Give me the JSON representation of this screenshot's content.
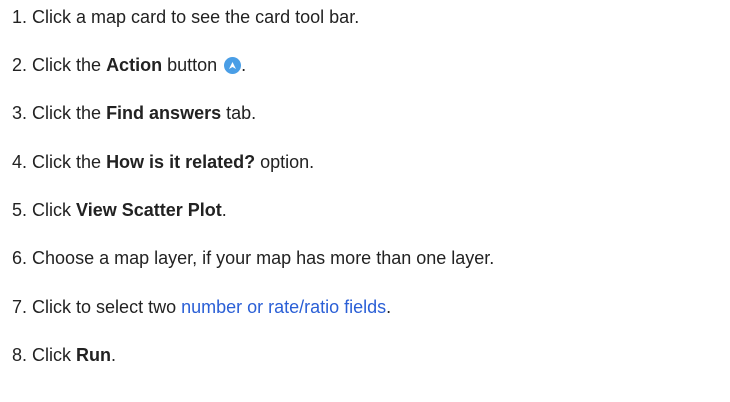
{
  "steps": [
    {
      "num": "1.",
      "text": "Click a map card to see the card tool bar."
    },
    {
      "num": "2.",
      "pre": "Click the ",
      "bold": "Action",
      "post": " button",
      "end": ".",
      "icon": "action-icon"
    },
    {
      "num": "3.",
      "pre": "Click the ",
      "bold": "Find answers",
      "post": " tab."
    },
    {
      "num": "4.",
      "pre": "Click the ",
      "bold": "How is it related?",
      "post": " option."
    },
    {
      "num": "5.",
      "pre": "Click ",
      "bold": "View Scatter Plot",
      "post": "."
    },
    {
      "num": "6.",
      "text": "Choose a map layer, if your map has more than one layer."
    },
    {
      "num": "7.",
      "pre": "Click to select two ",
      "link": "number or rate/ratio fields",
      "post": "."
    },
    {
      "num": "8.",
      "pre": "Click ",
      "bold": "Run",
      "post": "."
    }
  ],
  "colors": {
    "text": "#222222",
    "link": "#2a5fd6",
    "icon": "#4a9ee6"
  }
}
